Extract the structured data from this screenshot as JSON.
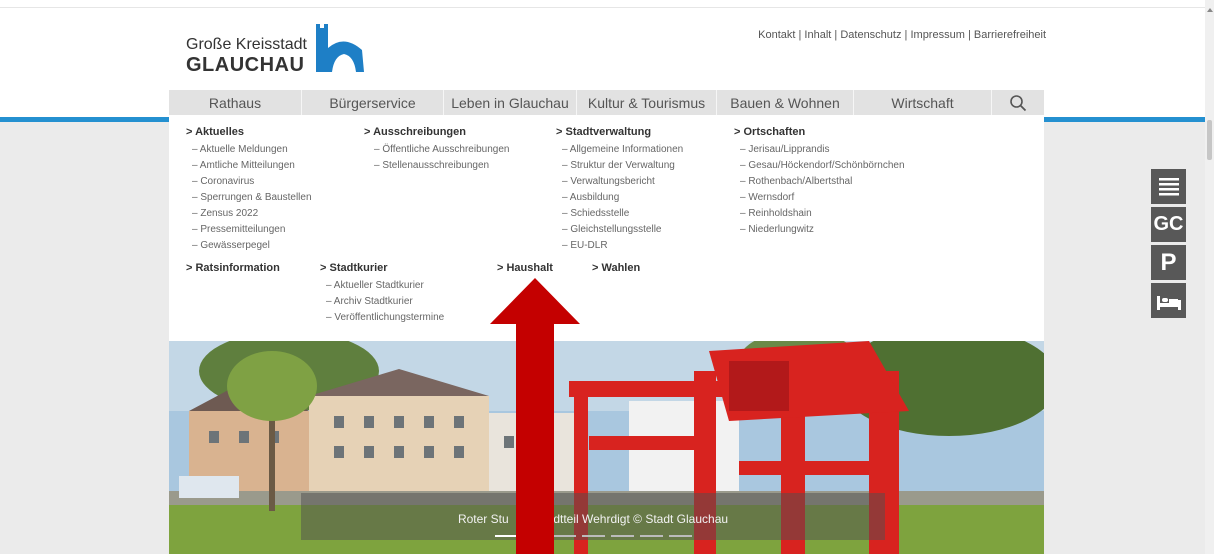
{
  "header": {
    "logo_line1": "Große Kreisstadt",
    "logo_line2": "GLAUCHAU",
    "service_links": [
      "Kontakt",
      "Inhalt",
      "Datenschutz",
      "Impressum",
      "Barrierefreiheit"
    ]
  },
  "nav": {
    "items": [
      "Rathaus",
      "Bürgerservice",
      "Leben in Glauchau",
      "Kultur & Tourismus",
      "Bauen & Wohnen",
      "Wirtschaft"
    ],
    "search_icon": "search-icon"
  },
  "menu": {
    "aktuelles": {
      "heading": "> Aktuelles",
      "items": [
        "– Aktuelle Meldungen",
        "– Amtliche Mitteilungen",
        "– Coronavirus",
        "– Sperrungen & Baustellen",
        "– Zensus 2022",
        "– Pressemitteilungen",
        "– Gewässerpegel"
      ]
    },
    "ausschreibungen": {
      "heading": "> Ausschreibungen",
      "items": [
        "– Öffentliche Ausschreibungen",
        "– Stellenausschreibungen"
      ]
    },
    "stadtverwaltung": {
      "heading": "> Stadtverwaltung",
      "items": [
        "– Allgemeine Informationen",
        "– Struktur der Verwaltung",
        "– Verwaltungsbericht",
        "– Ausbildung",
        "– Schiedsstelle",
        "– Gleichstellungsstelle",
        "– EU-DLR"
      ]
    },
    "ortschaften": {
      "heading": "> Ortschaften",
      "items": [
        "– Jerisau/Lipprandis",
        "– Gesau/Höckendorf/Schönbörnchen",
        "– Rothenbach/Albertsthal",
        "– Wernsdorf",
        "– Reinholdshain",
        "– Niederlungwitz"
      ]
    },
    "ratsinformation": {
      "heading": "> Ratsinformation"
    },
    "stadtkurier": {
      "heading": "> Stadtkurier",
      "items": [
        "– Aktueller Stadtkurier",
        "– Archiv Stadtkurier",
        "– Veröffentlichungstermine"
      ]
    },
    "haushalt": {
      "heading": "> Haushalt"
    },
    "wahlen": {
      "heading": "> Wahlen"
    }
  },
  "hero": {
    "caption_left": "Roter Stu",
    "caption_right": "adtteil Wehrdigt © Stadt Glauchau"
  },
  "quick_links": {
    "icons": [
      "menu-lines-icon",
      "gc-icon",
      "parking-icon",
      "bed-icon"
    ],
    "gc_label": "GC",
    "parking_label": "P"
  },
  "colors": {
    "accent_blue": "#2490d0",
    "annotation_red": "#c40000",
    "nav_bg": "#e2e2e2",
    "quick_bg": "#585858"
  }
}
